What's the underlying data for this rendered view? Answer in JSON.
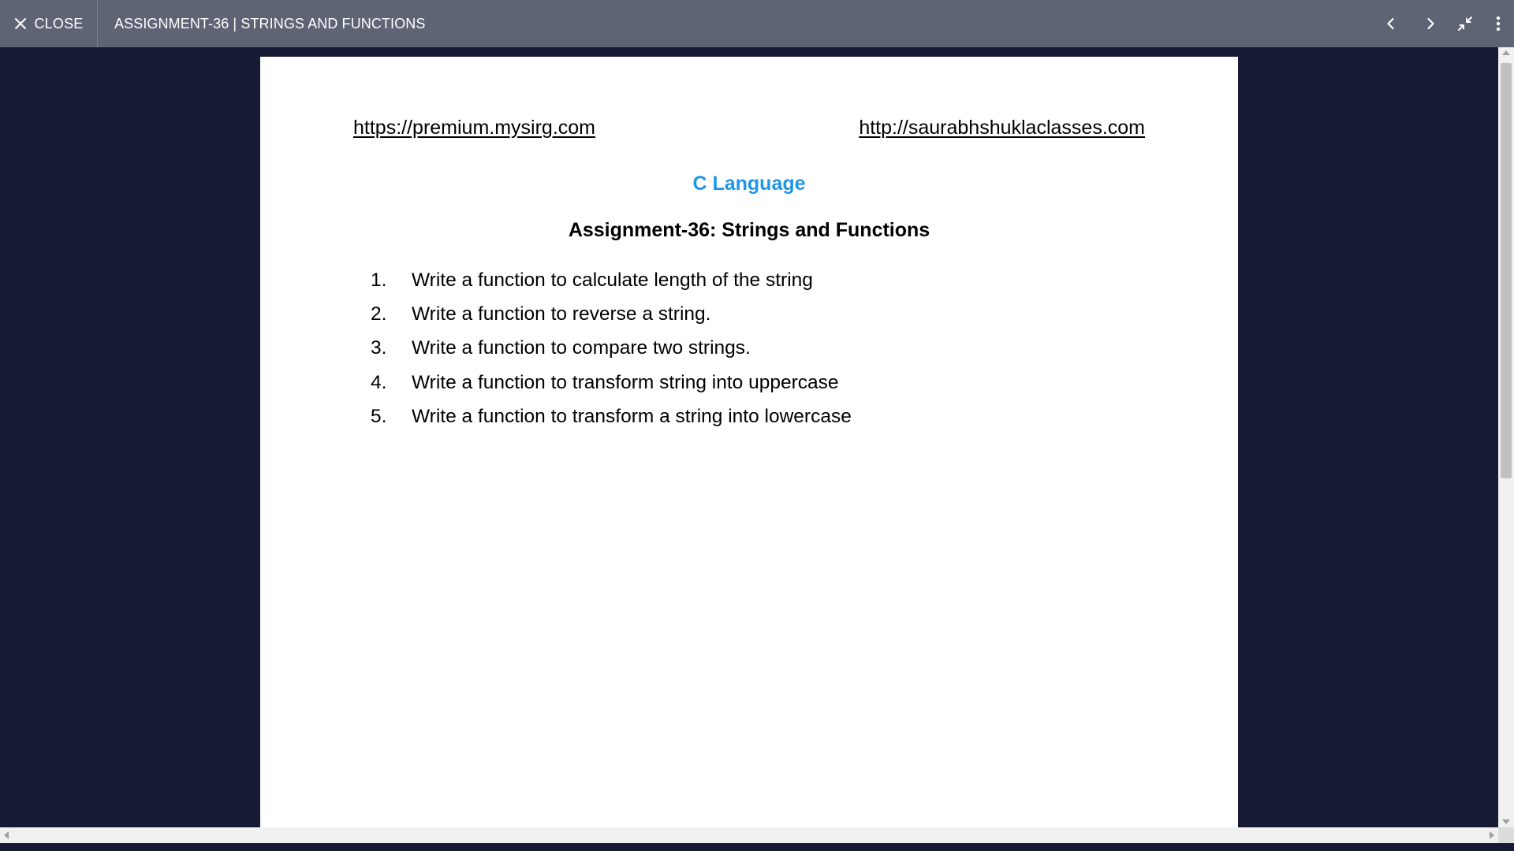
{
  "toolbar": {
    "close_label": "CLOSE",
    "title": "ASSIGNMENT-36 | STRINGS AND FUNCTIONS",
    "icons": [
      "close-icon",
      "chevron-left-icon",
      "chevron-right-icon",
      "exit-fullscreen-icon",
      "more-vertical-icon"
    ]
  },
  "document": {
    "link_left": "https://premium.mysirg.com",
    "link_right": "http://saurabhshuklaclasses.com",
    "language_title": "C Language",
    "assignment_title": "Assignment-36: Strings and Functions",
    "tasks": [
      {
        "num": "1.",
        "text": "Write a function to calculate length of the string"
      },
      {
        "num": "2.",
        "text": "Write a function to reverse a string."
      },
      {
        "num": "3.",
        "text": "Write a function to compare two strings."
      },
      {
        "num": "4.",
        "text": "Write a function to transform string into uppercase"
      },
      {
        "num": "5.",
        "text": "Write a function to transform a string into lowercase"
      }
    ]
  },
  "colors": {
    "toolbar_bg": "#5f6475",
    "viewer_bg": "#161a33",
    "accent_title": "#1e96e8"
  }
}
